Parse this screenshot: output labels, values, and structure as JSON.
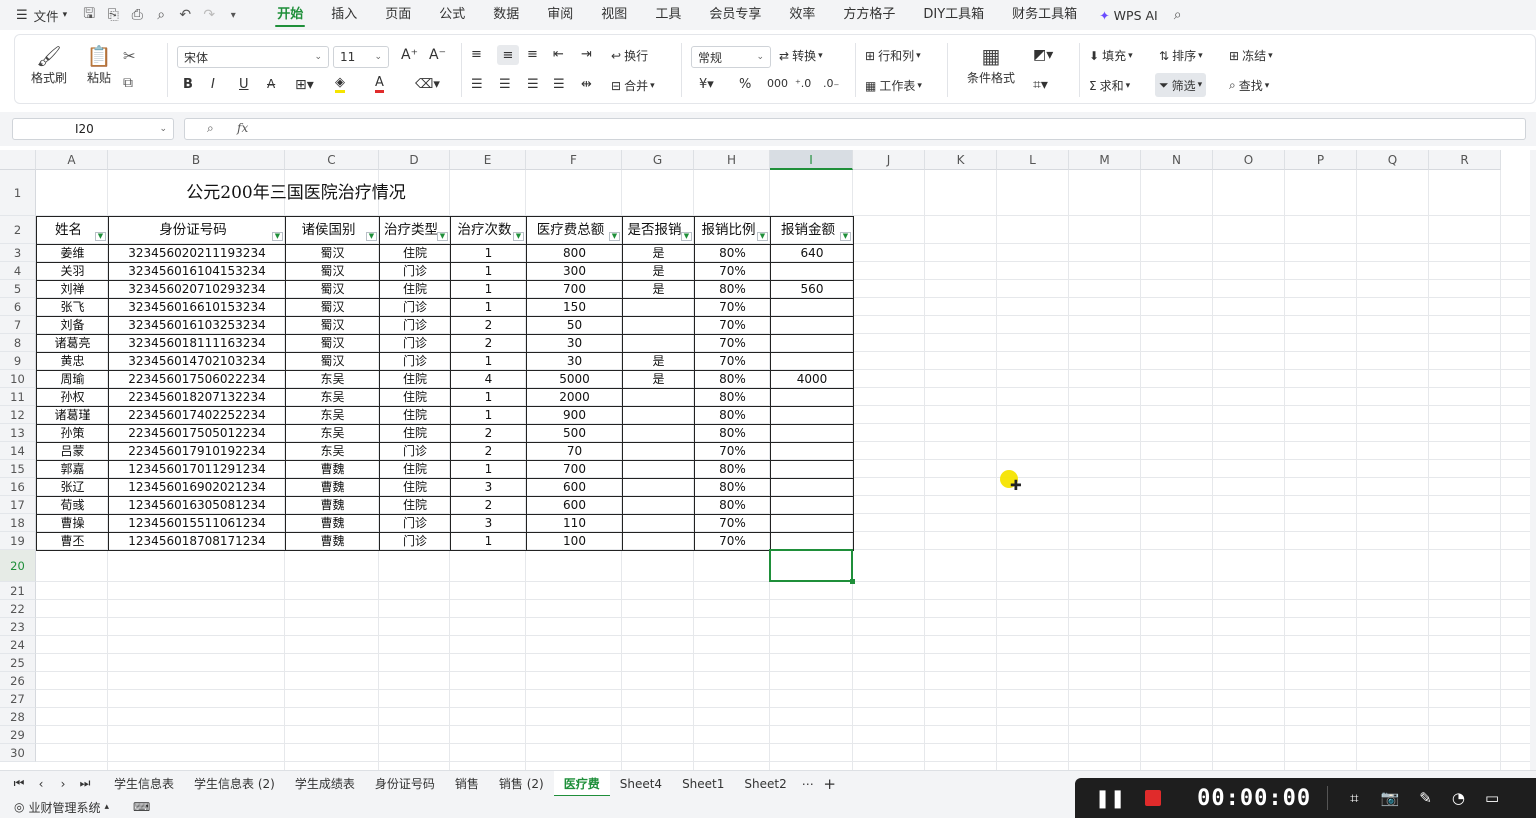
{
  "menubar": {
    "file_label": "文件",
    "tabs": [
      "开始",
      "插入",
      "页面",
      "公式",
      "数据",
      "审阅",
      "视图",
      "工具",
      "会员专享",
      "效率",
      "方方格子",
      "DIY工具箱",
      "财务工具箱"
    ],
    "active_tab": "开始",
    "wps_ai": "WPS AI"
  },
  "ribbon": {
    "format_painter": "格式刷",
    "paste": "粘贴",
    "font_name": "宋体",
    "font_size": "11",
    "wrap": "换行",
    "merge": "合并",
    "number_format": "常规",
    "convert": "转换",
    "row_col": "行和列",
    "worksheet": "工作表",
    "cond_format": "条件格式",
    "fill": "填充",
    "sort": "排序",
    "freeze": "冻结",
    "sum": "求和",
    "filter": "筛选",
    "find": "查找"
  },
  "formula_bar": {
    "cell_ref": "I20",
    "fx": "fx"
  },
  "columns": [
    "A",
    "B",
    "C",
    "D",
    "E",
    "F",
    "G",
    "H",
    "I",
    "J",
    "K",
    "L",
    "M",
    "N",
    "O",
    "P",
    "Q",
    "R"
  ],
  "selected_column": "I",
  "rows": [
    "1",
    "2",
    "3",
    "4",
    "5",
    "6",
    "7",
    "8",
    "9",
    "10",
    "11",
    "12",
    "13",
    "14",
    "15",
    "16",
    "17",
    "18",
    "19",
    "20",
    "21",
    "22",
    "23",
    "24",
    "25",
    "26",
    "27",
    "28",
    "29",
    "30"
  ],
  "selected_row": "20",
  "sheet": {
    "title": "公元200年三国医院治疗情况",
    "headers": [
      "姓名",
      "身份证号码",
      "诸侯国别",
      "治疗类型",
      "治疗次数",
      "医疗费总额",
      "是否报销",
      "报销比例",
      "报销金额"
    ],
    "records": [
      [
        "姜维",
        "323456020211193234",
        "蜀汉",
        "住院",
        "1",
        "800",
        "是",
        "80%",
        "640"
      ],
      [
        "关羽",
        "323456016104153234",
        "蜀汉",
        "门诊",
        "1",
        "300",
        "是",
        "70%",
        ""
      ],
      [
        "刘禅",
        "323456020710293234",
        "蜀汉",
        "住院",
        "1",
        "700",
        "是",
        "80%",
        "560"
      ],
      [
        "张飞",
        "323456016610153234",
        "蜀汉",
        "门诊",
        "1",
        "150",
        "",
        "70%",
        ""
      ],
      [
        "刘备",
        "323456016103253234",
        "蜀汉",
        "门诊",
        "2",
        "50",
        "",
        "70%",
        ""
      ],
      [
        "诸葛亮",
        "323456018111163234",
        "蜀汉",
        "门诊",
        "2",
        "30",
        "",
        "70%",
        ""
      ],
      [
        "黄忠",
        "323456014702103234",
        "蜀汉",
        "门诊",
        "1",
        "30",
        "是",
        "70%",
        ""
      ],
      [
        "周瑜",
        "223456017506022234",
        "东吴",
        "住院",
        "4",
        "5000",
        "是",
        "80%",
        "4000"
      ],
      [
        "孙权",
        "223456018207132234",
        "东吴",
        "住院",
        "1",
        "2000",
        "",
        "80%",
        ""
      ],
      [
        "诸葛瑾",
        "223456017402252234",
        "东吴",
        "住院",
        "1",
        "900",
        "",
        "80%",
        ""
      ],
      [
        "孙策",
        "223456017505012234",
        "东吴",
        "住院",
        "2",
        "500",
        "",
        "80%",
        ""
      ],
      [
        "吕蒙",
        "223456017910192234",
        "东吴",
        "门诊",
        "2",
        "70",
        "",
        "70%",
        ""
      ],
      [
        "郭嘉",
        "123456017011291234",
        "曹魏",
        "住院",
        "1",
        "700",
        "",
        "80%",
        ""
      ],
      [
        "张辽",
        "123456016902021234",
        "曹魏",
        "住院",
        "3",
        "600",
        "",
        "80%",
        ""
      ],
      [
        "荀彧",
        "123456016305081234",
        "曹魏",
        "住院",
        "2",
        "600",
        "",
        "80%",
        ""
      ],
      [
        "曹操",
        "123456015511061234",
        "曹魏",
        "门诊",
        "3",
        "110",
        "",
        "70%",
        ""
      ],
      [
        "曹丕",
        "123456018708171234",
        "曹魏",
        "门诊",
        "1",
        "100",
        "",
        "70%",
        ""
      ]
    ]
  },
  "sheet_tabs": [
    "学生信息表",
    "学生信息表 (2)",
    "学生成绩表",
    "身份证号码",
    "销售",
    "销售 (2)",
    "医疗费",
    "Sheet4",
    "Sheet1",
    "Sheet2"
  ],
  "active_sheet": "医疗费",
  "status": {
    "app": "业财管理系统"
  },
  "recorder": {
    "time": "00:00:00"
  },
  "colors": {
    "accent": "#1f8f3a",
    "recorder_stop": "#e02b2b",
    "cursor": "#f5e400"
  }
}
